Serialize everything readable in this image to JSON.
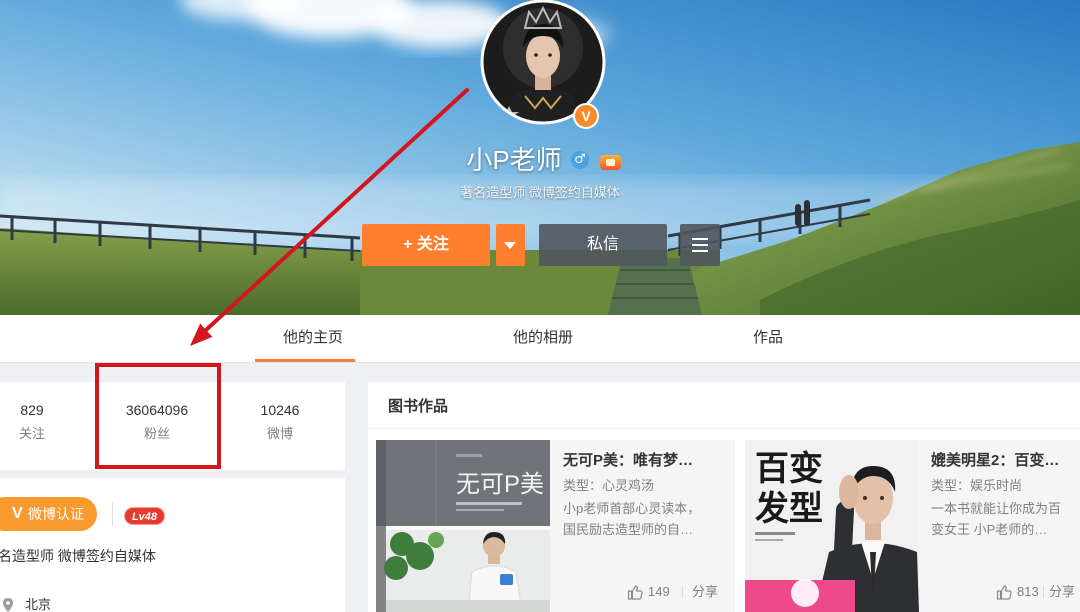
{
  "profile": {
    "name": "小P老师",
    "subtitle": "著名造型师 微博签约自媒体",
    "gender_icon": "male-icon",
    "gender_glyph": "♂",
    "member_icon": "vip-level-icon",
    "verified_icon": "verified-v-icon",
    "avatar_icon": "avatar"
  },
  "actions": {
    "follow_label": "+ 关注",
    "message_label": "私信",
    "dropdown_icon": "chevron-down-icon",
    "more_icon": "menu-icon"
  },
  "tabs": [
    {
      "label": "他的主页",
      "active": true
    },
    {
      "label": "他的相册",
      "active": false
    },
    {
      "label": "作品",
      "active": false
    }
  ],
  "stats": [
    {
      "value": "829",
      "label": "关注"
    },
    {
      "value": "36064096",
      "label": "粉丝",
      "highlighted": true
    },
    {
      "value": "10246",
      "label": "微博"
    }
  ],
  "verification": {
    "badge_mark": "V",
    "badge_label": "微博认证",
    "level": "Lv48",
    "description": "著名造型师 微博签约自媒体"
  },
  "location": {
    "icon": "location-pin-icon",
    "label": "北京"
  },
  "books": {
    "title": "图书作品",
    "items": [
      {
        "title": "无可P美：唯有梦…",
        "type": "类型：心灵鸡汤",
        "description": "小p老师首部心灵读本，国民励志造型师的自…",
        "likes": "149",
        "share": "分享",
        "like_icon": "thumbs-up-icon",
        "cover_lines": [
          "无可P美"
        ]
      },
      {
        "title": "媲美明星2：百变…",
        "type": "类型：娱乐时尚",
        "description": "一本书就能让你成为百变女王 小P老师的…",
        "likes": "813",
        "share": "分享",
        "like_icon": "thumbs-up-icon",
        "cover_lines": [
          "百变",
          "发型"
        ]
      }
    ]
  },
  "annotation": {
    "arrow_icon": "red-arrow-icon",
    "highlight_box": "red-highlight-box"
  },
  "colors": {
    "accent": "#ff7f2f",
    "tab_active": "#fa7d3c",
    "annotation_red": "#d3151c",
    "verify_orange": "#f99a2e",
    "level_red": "#e8392e",
    "button_gray": "#50565e",
    "male_blue": "#4aa3df"
  }
}
